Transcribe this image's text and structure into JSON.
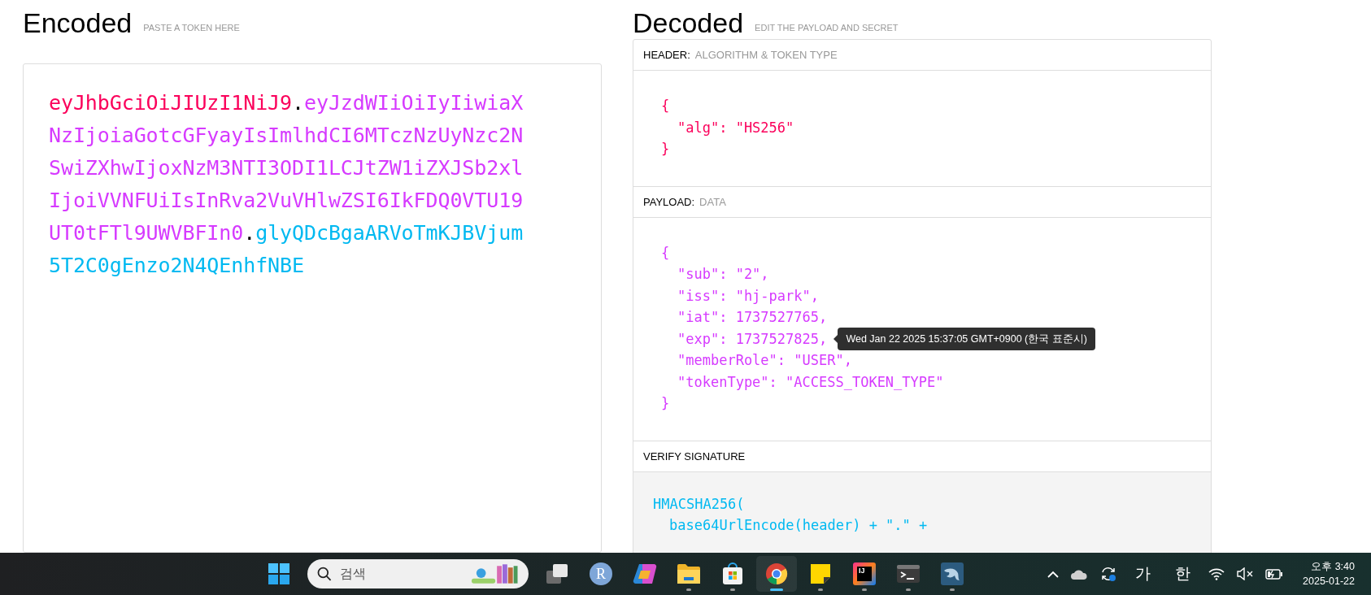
{
  "encoded": {
    "title": "Encoded",
    "hint": "PASTE A TOKEN HERE",
    "token": [
      {
        "text": "eyJhbGciOiJIUzI1NiJ9",
        "color": "#fb015b"
      },
      {
        "text": ".",
        "color": "#000000"
      },
      {
        "text": "eyJzdWIiOiIyIiwiaXNzIjoiaGotcGFyayIsImlhdCI6MTczNzUyNzc2NSwiZXhwIjoxNzM3NTI3ODI1LCJtZW1iZXJSb2xlIjoiVVNFUiIsInRva2VuVHlwZSI6IkFDQ0VTU19UT0tFTl9UWVBFIn0",
        "color": "#d63aff"
      },
      {
        "text": ".",
        "color": "#000000"
      },
      {
        "text": "glyQDcBgaARVoTmKJBVjum5T2C0gEnzo2N4QEnhfNBE",
        "color": "#00b9f1"
      }
    ]
  },
  "decoded": {
    "title": "Decoded",
    "hint": "EDIT THE PAYLOAD AND SECRET",
    "sections": [
      {
        "label": "HEADER:",
        "sublabel": "ALGORITHM & TOKEN TYPE",
        "kind": "json",
        "color": "#fb015b",
        "open": "{",
        "close": "}",
        "entries": [
          {
            "text": "\"alg\": \"HS256\""
          }
        ]
      },
      {
        "label": "PAYLOAD:",
        "sublabel": "DATA",
        "kind": "json",
        "color": "#d63aff",
        "open": "{",
        "close": "}",
        "entries": [
          {
            "text": "\"sub\": \"2\","
          },
          {
            "text": "\"iss\": \"hj-park\","
          },
          {
            "text": "\"iat\": 1737527765,"
          },
          {
            "text": "\"exp\": 1737527825,",
            "tooltip": "Wed Jan 22 2025 15:37:05 GMT+0900 (한국 표준시)"
          },
          {
            "text": "\"memberRole\": \"USER\","
          },
          {
            "text": "\"tokenType\": \"ACCESS_TOKEN_TYPE\""
          }
        ]
      },
      {
        "label": "VERIFY SIGNATURE",
        "kind": "code",
        "color": "#00b9f1",
        "lines": [
          "HMACSHA256(",
          "base64UrlEncode(header) + \".\" +"
        ]
      }
    ]
  },
  "taskbar": {
    "apps": [
      {
        "kind": "start",
        "running": false,
        "selected": false
      },
      {
        "kind": "search",
        "placeholder": "검색"
      },
      {
        "kind": "taskview",
        "running": false,
        "selected": false
      },
      {
        "kind": "avatar",
        "text": "R",
        "running": false,
        "selected": false
      },
      {
        "kind": "copilot",
        "running": false,
        "selected": false
      },
      {
        "kind": "folder",
        "running": true,
        "selected": false
      },
      {
        "kind": "store",
        "running": true,
        "selected": false
      },
      {
        "kind": "browser",
        "running": true,
        "selected": true
      },
      {
        "kind": "note",
        "running": true,
        "selected": false
      },
      {
        "kind": "ide",
        "text": "IJ",
        "running": true,
        "selected": false
      },
      {
        "kind": "terminal",
        "running": true,
        "selected": false
      },
      {
        "kind": "database",
        "running": true,
        "selected": false
      }
    ],
    "tray": [
      {
        "kind": "chevron"
      },
      {
        "kind": "cloud"
      },
      {
        "kind": "sync"
      },
      {
        "kind": "ime",
        "text": "가"
      },
      {
        "kind": "ime",
        "text": "한"
      },
      {
        "kind": "wifi"
      },
      {
        "kind": "volume",
        "muted": true
      },
      {
        "kind": "battery"
      }
    ],
    "clock": {
      "time": "오후 3:40",
      "date": "2025-01-22"
    }
  }
}
